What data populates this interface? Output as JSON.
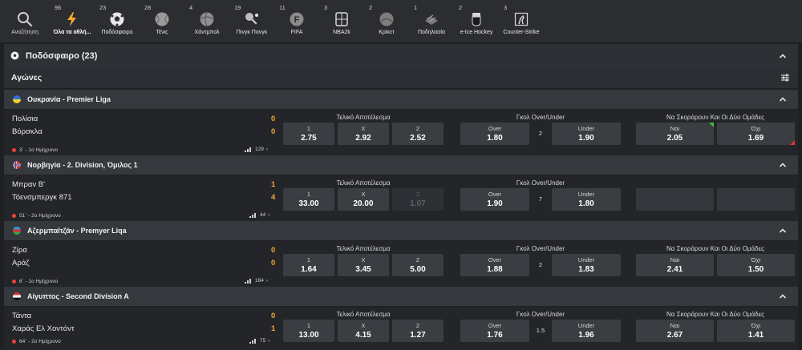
{
  "sportbar": {
    "search_label": "Αναζήτηση",
    "items": [
      {
        "count": "96",
        "label": "Όλα τα αθλή...",
        "icon": "lightning-icon"
      },
      {
        "count": "23",
        "label": "Ποδόσφαιρο",
        "icon": "soccer-ball-icon"
      },
      {
        "count": "28",
        "label": "Τένις",
        "icon": "tennis-ball-icon"
      },
      {
        "count": "4",
        "label": "Χάντμπολ",
        "icon": "handball-icon"
      },
      {
        "count": "19",
        "label": "Πινγκ Πονγκ",
        "icon": "table-tennis-icon"
      },
      {
        "count": "11",
        "label": "FIFA",
        "icon": "fifa-icon"
      },
      {
        "count": "3",
        "label": "NBA2k",
        "icon": "nba2k-icon"
      },
      {
        "count": "2",
        "label": "Κρίκετ",
        "icon": "cricket-ball-icon"
      },
      {
        "count": "1",
        "label": "Ποδηλασία",
        "icon": "cycling-icon"
      },
      {
        "count": "2",
        "label": "e-Ice Hockey",
        "icon": "ice-hockey-icon"
      },
      {
        "count": "3",
        "label": "Counter-Strike",
        "icon": "counter-strike-icon"
      }
    ]
  },
  "section": {
    "title": "Ποδόσφαιρο (23)"
  },
  "subheader": {
    "title": "Αγώνες"
  },
  "colors": {
    "accent": "#f7a531",
    "live": "#e8423c",
    "up": "#38c03e",
    "down": "#e0383a"
  },
  "leagues": [
    {
      "name": "Ουκρανία  -  Premier Liga",
      "flag": "ukraine",
      "match": {
        "home": "Πολίσια",
        "away": "Βόρσκλα",
        "home_score": "0",
        "away_score": "0",
        "time": "3΄ - 1ο Ημίχρονο",
        "markets_count": "129",
        "result_label": "Τελικό Αποτέλεσμα",
        "result": [
          {
            "k": "1",
            "v": "2.75"
          },
          {
            "k": "Χ",
            "v": "2.92"
          },
          {
            "k": "2",
            "v": "2.52"
          }
        ],
        "ou_label": "Γκολ Over/Under",
        "ou_line": "2",
        "over": {
          "k": "Over",
          "v": "1.80"
        },
        "under": {
          "k": "Under",
          "v": "1.90"
        },
        "btts_label": "Να Σκοράρουν Και Οι Δύο Ομάδες",
        "yes": {
          "k": "Ναι",
          "v": "2.05"
        },
        "no": {
          "k": "Όχι",
          "v": "1.69"
        }
      }
    },
    {
      "name": "Νορβηγία  -  2. Division, Όμιλος 1",
      "flag": "norway",
      "match": {
        "home": "Μπραν Β'",
        "away": "Τόενσμπεργκ 871",
        "home_score": "1",
        "away_score": "4",
        "time": "51΄ - 2ο Ημίχρονο",
        "markets_count": "44",
        "result_label": "Τελικό Αποτέλεσμα",
        "result": [
          {
            "k": "1",
            "v": "33.00"
          },
          {
            "k": "Χ",
            "v": "20.00"
          },
          {
            "k": "2",
            "v": "1.07"
          }
        ],
        "ou_label": "Γκολ Over/Under",
        "ou_line": "7",
        "over": {
          "k": "Over",
          "v": "1.90"
        },
        "under": {
          "k": "Under",
          "v": "1.80"
        },
        "btts_label": "",
        "yes": {
          "k": "",
          "v": ""
        },
        "no": {
          "k": "",
          "v": ""
        }
      }
    },
    {
      "name": "Αζερμπαϊτζάν  -  Premyer Liqa",
      "flag": "azerbaijan",
      "match": {
        "home": "Ζίρα",
        "away": "Αράζ",
        "home_score": "0",
        "away_score": "0",
        "time": "6΄ - 1ο Ημίχρονο",
        "markets_count": "164",
        "result_label": "Τελικό Αποτέλεσμα",
        "result": [
          {
            "k": "1",
            "v": "1.64"
          },
          {
            "k": "Χ",
            "v": "3.45"
          },
          {
            "k": "2",
            "v": "5.00"
          }
        ],
        "ou_label": "Γκολ Over/Under",
        "ou_line": "2",
        "over": {
          "k": "Over",
          "v": "1.88"
        },
        "under": {
          "k": "Under",
          "v": "1.83"
        },
        "btts_label": "Να Σκοράρουν Και Οι Δύο Ομάδες",
        "yes": {
          "k": "Ναι",
          "v": "2.41"
        },
        "no": {
          "k": "Όχι",
          "v": "1.50"
        }
      }
    },
    {
      "name": "Αίγυπτος  -  Second Division A",
      "flag": "egypt",
      "match": {
        "home": "Τάντα",
        "away": "Χαράς Ελ Χοντόντ",
        "home_score": "0",
        "away_score": "1",
        "time": "64΄ - 2ο Ημίχρονο",
        "markets_count": "75",
        "result_label": "Τελικό Αποτέλεσμα",
        "result": [
          {
            "k": "1",
            "v": "13.00"
          },
          {
            "k": "Χ",
            "v": "4.15"
          },
          {
            "k": "2",
            "v": "1.27"
          }
        ],
        "ou_label": "Γκολ Over/Under",
        "ou_line": "1.5",
        "over": {
          "k": "Over",
          "v": "1.76"
        },
        "under": {
          "k": "Under",
          "v": "1.96"
        },
        "btts_label": "Να Σκοράρουν Και Οι Δύο Ομάδες",
        "yes": {
          "k": "Ναι",
          "v": "2.67"
        },
        "no": {
          "k": "Όχι",
          "v": "1.41"
        }
      }
    }
  ]
}
